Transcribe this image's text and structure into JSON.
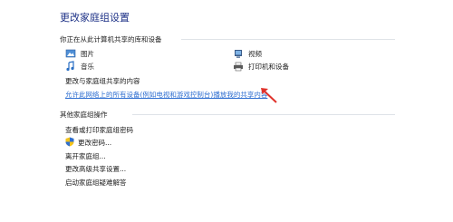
{
  "page": {
    "title": "更改家庭组设置"
  },
  "shared_section": {
    "heading": "你正在从此计算机共享的库和设备",
    "items": [
      {
        "label": "图片",
        "icon": "pictures-icon"
      },
      {
        "label": "视频",
        "icon": "videos-icon"
      },
      {
        "label": "音乐",
        "icon": "music-icon"
      },
      {
        "label": "打印机和设备",
        "icon": "printer-icon"
      }
    ],
    "change_link": "更改与家庭组共享的内容",
    "allow_link": "允许此网络上的所有设备(例如电视和游戏控制台)播放我的共享内容"
  },
  "other_section": {
    "heading": "其他家庭组操作",
    "links": [
      "查看或打印家庭组密码",
      "更改密码...",
      "离开家庭组...",
      "更改高级共享设置...",
      "启动家庭组疑难解答"
    ]
  },
  "colors": {
    "title": "#1e3287",
    "link_blue": "#2f6fd1",
    "annotation_arrow": "#e0322b",
    "divider": "#dfe3e8"
  }
}
